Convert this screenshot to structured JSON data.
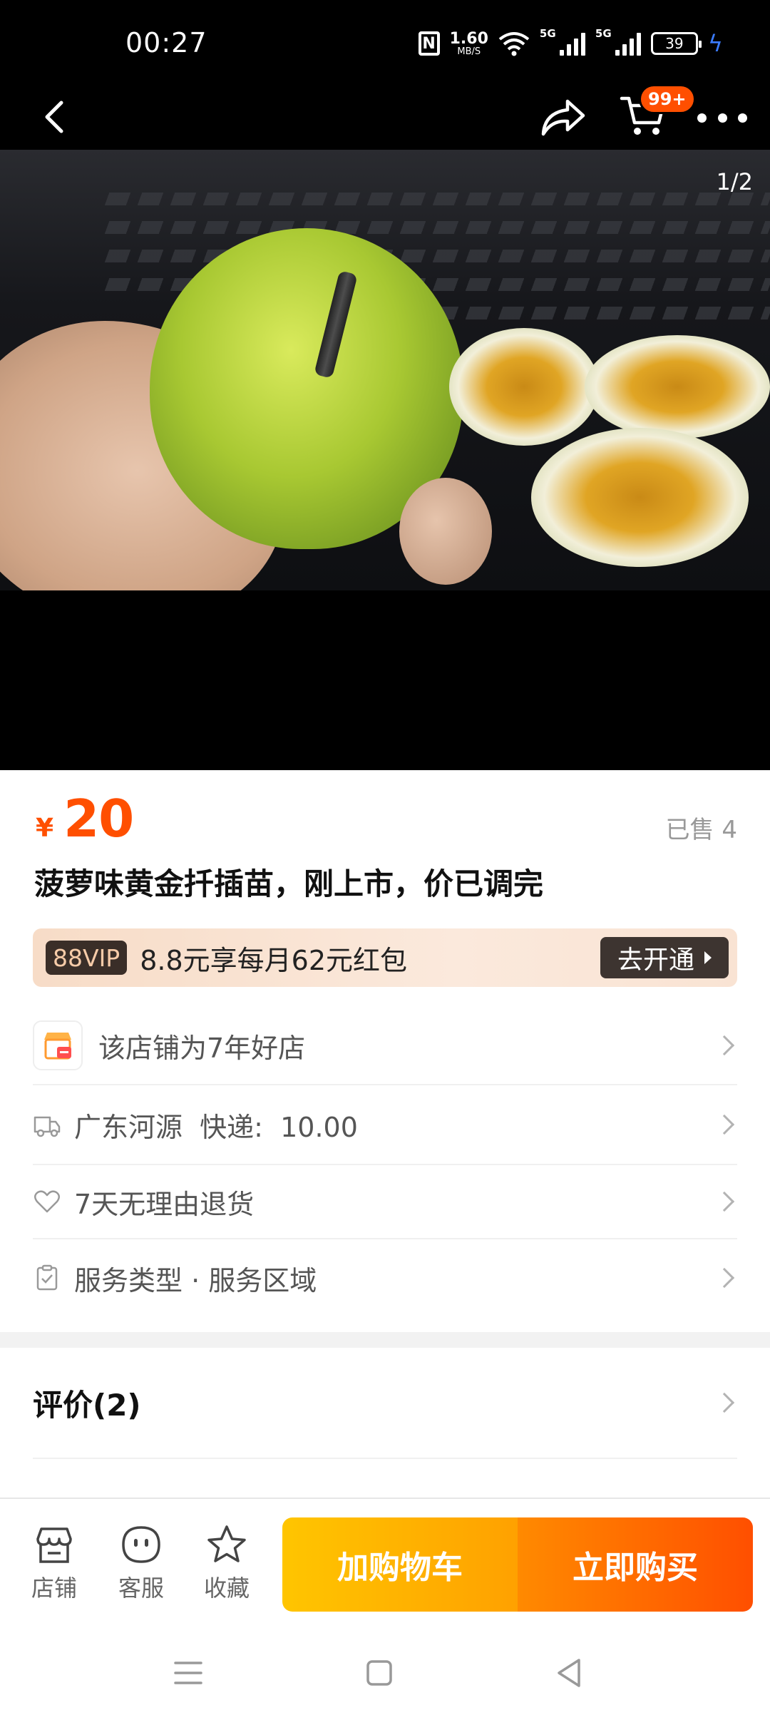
{
  "status_bar": {
    "time": "00:27",
    "net_speed_value": "1.60",
    "net_speed_unit": "MB/S",
    "signal_1_label": "5G",
    "signal_2_label": "5G",
    "battery": "39"
  },
  "nav": {
    "cart_badge": "99+"
  },
  "gallery": {
    "counter": "1/2"
  },
  "product": {
    "currency": "¥",
    "price": "20",
    "sold": "已售 4",
    "title": "菠萝味黄金扦插苗，刚上市，价已调完"
  },
  "vip": {
    "tag": "88VIP",
    "text": "8.8元享每月62元红包",
    "button": "去开通"
  },
  "info_rows": {
    "shop": "该店铺为7年好店",
    "shipping": "广东河源  快递:  10.00",
    "returns": "7天无理由退货",
    "service": "服务类型 · 服务区域"
  },
  "review": {
    "label": "评价(2)"
  },
  "action_bar": {
    "store": "店铺",
    "service": "客服",
    "favorite": "收藏",
    "add_to_cart": "加购物车",
    "buy_now": "立即购买"
  },
  "colors": {
    "accent": "#ff4f00",
    "cart_gradient_start": "#ffc500",
    "buy_gradient_end": "#ff4f00"
  }
}
